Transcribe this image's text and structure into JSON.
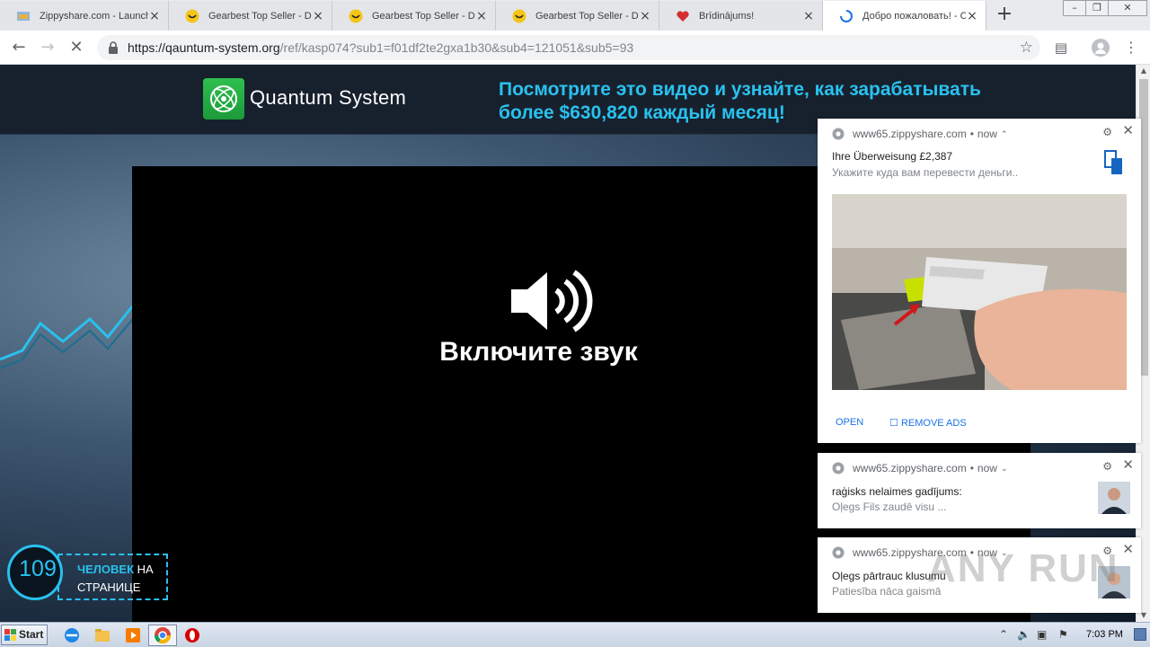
{
  "browser": {
    "tabs": [
      {
        "title": "Zippyshare.com - Launch",
        "favicon": "zippyshare-icon",
        "active": false
      },
      {
        "title": "Gearbest Top Seller - Div",
        "favicon": "gearbest-icon",
        "active": false
      },
      {
        "title": "Gearbest Top Seller - Div",
        "favicon": "gearbest-icon",
        "active": false
      },
      {
        "title": "Gearbest Top Seller - Div",
        "favicon": "gearbest-icon",
        "active": false
      },
      {
        "title": "Brīdinājums!",
        "favicon": "heart-icon",
        "active": false
      },
      {
        "title": "Добро пожаловать! - С",
        "favicon": "loading-spinner-icon",
        "active": true
      }
    ],
    "url_host": "https://qauntum-system.org",
    "url_path": "/ref/kasp074?sub1=f01df2te2gxa1b30&sub4=121051&sub5=93"
  },
  "site": {
    "logo_text": "Quantum System",
    "headline_line1": "Посмотрите это видео и узнайте, как зарабатывать",
    "headline_line2": "более $630,820 каждый месяц!",
    "video_prompt": "Включите звук",
    "counter_number": "109",
    "counter_label_highlight": "ЧЕЛОВЕК",
    "counter_label_rest": " НА",
    "counter_label_line2": "СТРАНИЦЕ"
  },
  "notifications": [
    {
      "source": "www65.zippyshare.com",
      "time": "now",
      "title": "Ihre Überweisung £2,387",
      "body": "Укажите куда вам перевести деньги..",
      "actions": {
        "open": "OPEN",
        "remove_ads": "REMOVE ADS"
      }
    },
    {
      "source": "www65.zippyshare.com",
      "time": "now",
      "title": "raģisks nelaimes gadījums:",
      "body": "Oļegs Fils zaudē visu ..."
    },
    {
      "source": "www65.zippyshare.com",
      "time": "now",
      "title": "Oļegs pārtrauc klusumu",
      "body": "Patiesība nāca gaismā"
    }
  ],
  "taskbar": {
    "start_label": "Start",
    "clock": "7:03 PM"
  },
  "watermark": "ANY RUN",
  "colors": {
    "accent_cyan": "#29c1ef",
    "logo_green": "#2fbf4f",
    "header_dark": "#17212d"
  }
}
